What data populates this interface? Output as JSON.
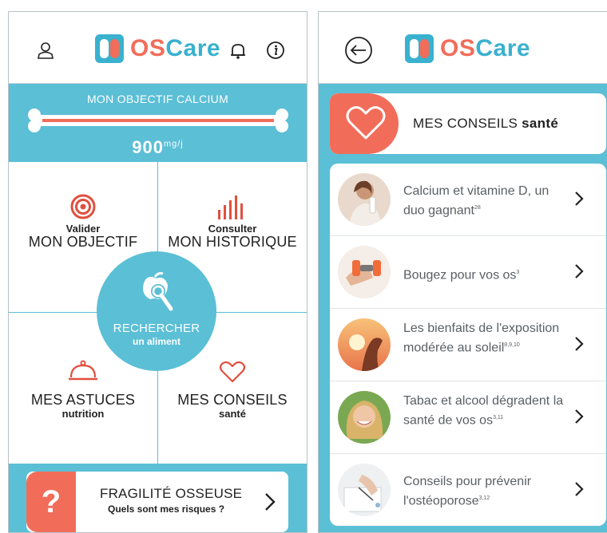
{
  "left_screen": {
    "brand": {
      "os": "OS",
      "care": "Care"
    },
    "header_icons": [
      "user-icon",
      "bell-icon",
      "info-icon"
    ],
    "goal": {
      "title": "MON OBJECTIF CALCIUM",
      "value": "900",
      "unit": "mg/j"
    },
    "grid": {
      "objectif": {
        "small": "Valider",
        "big": "MON OBJECTIF",
        "icon": "target-icon"
      },
      "historique": {
        "small": "Consulter",
        "big": "MON HISTORIQUE",
        "icon": "bar-chart-icon"
      },
      "astuces": {
        "big": "MES ASTUCES",
        "small": "nutrition",
        "icon": "cloche-icon"
      },
      "conseils": {
        "big": "MES CONSEILS",
        "small": "santé",
        "icon": "heart-icon"
      }
    },
    "search": {
      "big": "RECHERCHER",
      "small": "un aliment",
      "icon": "apple-search-icon"
    },
    "fragility": {
      "badge": "?",
      "title": "FRAGILITÉ OSSEUSE",
      "subtitle": "Quels sont mes risques ?"
    }
  },
  "right_screen": {
    "brand": {
      "os": "OS",
      "care": "Care"
    },
    "header": {
      "title_main": "MES CONSEILS",
      "title_bold": "santé"
    },
    "advice_items": [
      {
        "text": "Calcium et vitamine D, un duo gagnant",
        "ref": "28"
      },
      {
        "text": "Bougez pour vos os",
        "ref": "3"
      },
      {
        "text": "Les bienfaits de l'exposition modérée au soleil",
        "ref": "8,9,10"
      },
      {
        "text": "Tabac et alcool dégradent la santé de vos os",
        "ref": "3,11"
      },
      {
        "text": "Conseils pour prévenir l'ostéoporose",
        "ref": "3,12"
      }
    ]
  },
  "colors": {
    "teal": "#5bbfd6",
    "brand_teal": "#3ab1cf",
    "coral": "#f16d5a",
    "text": "#222222"
  }
}
